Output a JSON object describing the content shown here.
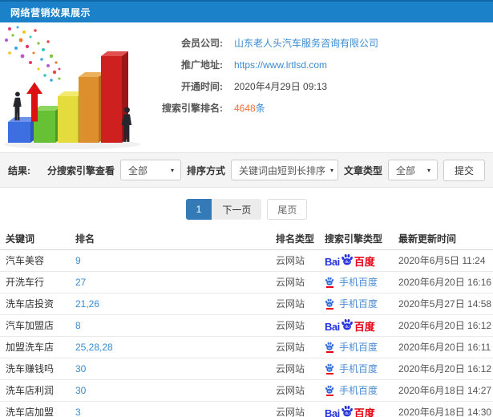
{
  "header": {
    "title": "网络营销效果展示"
  },
  "info": {
    "fields": [
      {
        "label": "会员公司:",
        "value": "山东老人头汽车服务咨询有限公司",
        "type": "link"
      },
      {
        "label": "推广地址:",
        "value": "https://www.lrtlsd.com",
        "type": "link"
      },
      {
        "label": "开通时间:",
        "value": "2020年4月29日 09:13",
        "type": "text"
      },
      {
        "label": "搜索引擎排名:",
        "value": "4648",
        "suffix": "条",
        "type": "highlight"
      }
    ]
  },
  "filters": {
    "result_label": "结果:",
    "engine_label": "分搜索引擎查看",
    "engine_value": "全部",
    "sort_label": "排序方式",
    "sort_value": "关键词由短到长排序",
    "article_label": "文章类型",
    "article_value": "全部",
    "submit_label": "提交",
    "caret": "▾"
  },
  "pagination": {
    "current": "1",
    "next": "下一页",
    "last": "尾页"
  },
  "table": {
    "headers": [
      "关键词",
      "排名",
      "排名类型",
      "搜索引擎类型",
      "最新更新时间"
    ],
    "engines": {
      "baidu": {
        "prefix": "Bai",
        "paw_text": "du",
        "cn": "百度"
      },
      "mobile": {
        "label": "手机百度",
        "paw_text": "du"
      }
    },
    "rows": [
      {
        "keyword": "汽车美容",
        "rank": "9",
        "rank_type": "云网站",
        "engine": "baidu",
        "updated": "2020年6月5日 11:24"
      },
      {
        "keyword": "开洗车行",
        "rank": "27",
        "rank_type": "云网站",
        "engine": "mobile",
        "updated": "2020年6月20日 16:16"
      },
      {
        "keyword": "洗车店投资",
        "rank": "21,26",
        "rank_type": "云网站",
        "engine": "mobile",
        "updated": "2020年5月27日 14:58"
      },
      {
        "keyword": "汽车加盟店",
        "rank": "8",
        "rank_type": "云网站",
        "engine": "baidu",
        "updated": "2020年6月20日 16:12"
      },
      {
        "keyword": "加盟洗车店",
        "rank": "25,28,28",
        "rank_type": "云网站",
        "engine": "mobile",
        "updated": "2020年6月20日 16:11"
      },
      {
        "keyword": "洗车赚钱吗",
        "rank": "30",
        "rank_type": "云网站",
        "engine": "mobile",
        "updated": "2020年6月20日 16:12"
      },
      {
        "keyword": "洗车店利润",
        "rank": "30",
        "rank_type": "云网站",
        "engine": "mobile",
        "updated": "2020年6月18日 14:27"
      },
      {
        "keyword": "洗车店加盟",
        "rank": "3",
        "rank_type": "云网站",
        "engine": "baidu",
        "updated": "2020年6月18日 14:30"
      }
    ]
  },
  "colors": {
    "header_blue": "#1b82ca",
    "link_blue": "#3a8bd0",
    "highlight_orange": "#f0703a",
    "baidu_blue": "#2433dc",
    "baidu_red": "#e60012",
    "pagination_active_blue": "#337ab7"
  }
}
